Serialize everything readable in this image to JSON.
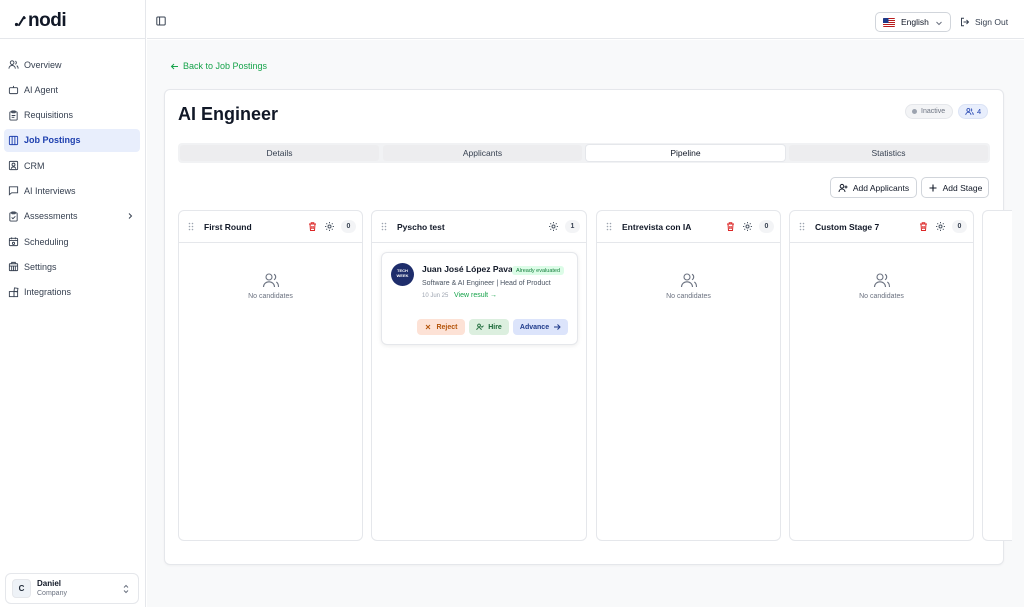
{
  "brand": {
    "logo_text": "nodi"
  },
  "sidebar": {
    "items": [
      {
        "label": "Overview",
        "icon": "users-icon",
        "active": false
      },
      {
        "label": "AI Agent",
        "icon": "bot-icon",
        "active": false
      },
      {
        "label": "Requisitions",
        "icon": "clipboard-icon",
        "active": false
      },
      {
        "label": "Job Postings",
        "icon": "columns-icon",
        "active": true
      },
      {
        "label": "CRM",
        "icon": "contact-icon",
        "active": false
      },
      {
        "label": "AI Interviews",
        "icon": "message-icon",
        "active": false
      },
      {
        "label": "Assessments",
        "icon": "clipboard-check-icon",
        "active": false
      },
      {
        "label": "Scheduling",
        "icon": "calendar-icon",
        "active": false
      },
      {
        "label": "Settings",
        "icon": "building-icon",
        "active": false
      },
      {
        "label": "Integrations",
        "icon": "blocks-icon",
        "active": false
      }
    ],
    "user": {
      "initial": "C",
      "name": "Daniel",
      "company": "Company"
    }
  },
  "topbar": {
    "language": "English",
    "sign_out": "Sign Out"
  },
  "main": {
    "back_link": "Back to Job Postings",
    "title": "AI Engineer",
    "status": "Inactive",
    "applicant_count": "4",
    "tabs": [
      {
        "label": "Details",
        "active": false
      },
      {
        "label": "Applicants",
        "active": false
      },
      {
        "label": "Pipeline",
        "active": true
      },
      {
        "label": "Statistics",
        "active": false
      }
    ],
    "add_applicants": "Add Applicants",
    "add_stage": "Add Stage",
    "stages": [
      {
        "title": "First Round",
        "count": "0",
        "empty_text": "No candidates"
      },
      {
        "title": "Pyscho test",
        "count": "1"
      },
      {
        "title": "Entrevista con IA",
        "count": "0",
        "empty_text": "No candidates"
      },
      {
        "title": "Custom Stage 7",
        "count": "0",
        "empty_text": "No candidates"
      }
    ],
    "candidate": {
      "logo_text": "TECH WEEK",
      "name": "Juan José López Pava",
      "badge": "Already evaluated",
      "role": "Software & AI Engineer | Head of Product",
      "date": "10 Jun 25",
      "view_result": "View result →",
      "reject": "Reject",
      "hire": "Hire",
      "advance": "Advance"
    }
  },
  "colors": {
    "accent": "#16a34a",
    "active_nav": "#e8eefc",
    "delete": "#dc2626"
  }
}
